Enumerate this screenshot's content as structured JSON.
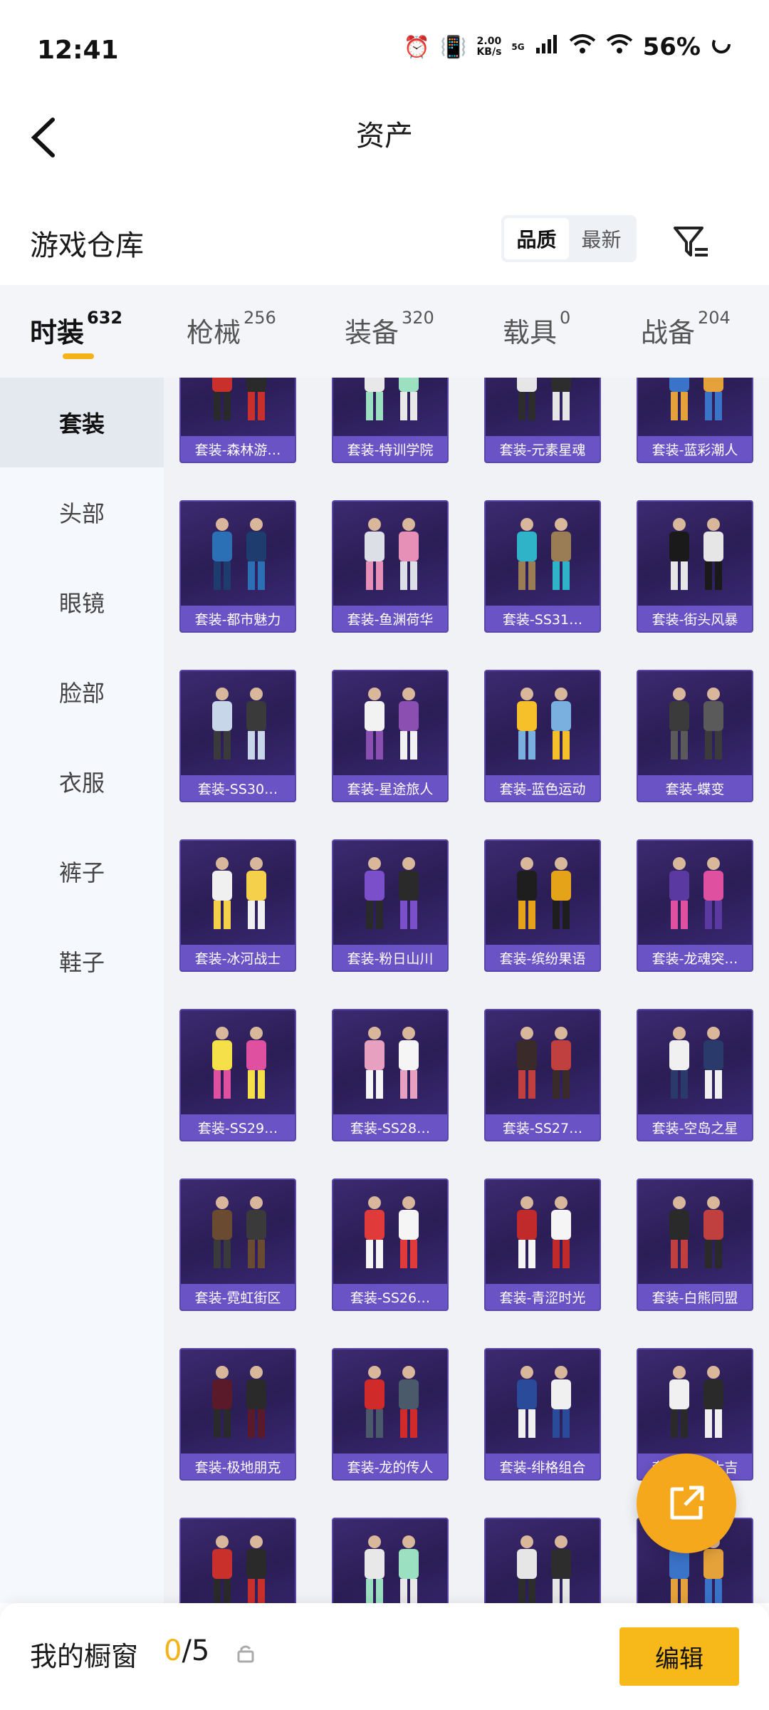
{
  "status": {
    "time": "12:41",
    "net_speed_value": "2.00",
    "net_speed_unit": "KB/s",
    "network": "5G",
    "battery": "56%"
  },
  "header": {
    "title": "资产"
  },
  "section": {
    "title": "游戏仓库",
    "sort_options": [
      "品质",
      "最新"
    ],
    "sort_selected": "品质"
  },
  "tabs": [
    {
      "label": "时装",
      "count": "632",
      "active": true
    },
    {
      "label": "枪械",
      "count": "256",
      "active": false
    },
    {
      "label": "装备",
      "count": "320",
      "active": false
    },
    {
      "label": "载具",
      "count": "0",
      "active": false
    },
    {
      "label": "战备",
      "count": "204",
      "active": false
    }
  ],
  "sidebar": [
    {
      "label": "套装",
      "active": true
    },
    {
      "label": "头部",
      "active": false
    },
    {
      "label": "眼镜",
      "active": false
    },
    {
      "label": "脸部",
      "active": false
    },
    {
      "label": "衣服",
      "active": false
    },
    {
      "label": "裤子",
      "active": false
    },
    {
      "label": "鞋子",
      "active": false
    }
  ],
  "items": [
    "套装-森林游…",
    "套装-特训学院",
    "套装-元素星魂",
    "套装-蓝彩潮人",
    "套装-都市魅力",
    "套装-鱼渊荷华",
    "套装-SS31…",
    "套装-街头风暴",
    "套装-SS30…",
    "套装-星途旅人",
    "套装-蓝色运动",
    "套装-蝶变",
    "套装-冰河战士",
    "套装-粉日山川",
    "套装-缤纷果语",
    "套装-龙魂突…",
    "套装-SS29…",
    "套装-SS28…",
    "套装-SS27…",
    "套装-空岛之星",
    "套装-霓虹街区",
    "套装-SS26…",
    "套装-青涩时光",
    "套装-白熊同盟",
    "套装-极地朋克",
    "套装-龙的传人",
    "套装-绯格组合",
    "套装-六六大吉",
    "",
    "",
    "",
    ""
  ],
  "footer": {
    "title": "我的橱窗",
    "used": "0",
    "total": "/5",
    "edit_label": "编辑"
  },
  "colors": {
    "accent": "#f5b216",
    "card_bg": "#2b1d55",
    "card_label": "#6a53c4"
  }
}
